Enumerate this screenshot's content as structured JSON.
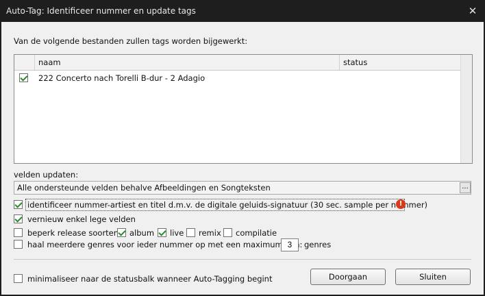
{
  "window": {
    "title": "Auto-Tag: Identificeer nummer en update tags"
  },
  "intro": "Van de volgende bestanden zullen tags worden bijgewerkt:",
  "table": {
    "columns": [
      "naam",
      "status"
    ],
    "rows": [
      {
        "checked": true,
        "name": "222 Concerto nach Torelli B-dur - 2 Adagio",
        "status": ""
      }
    ]
  },
  "fields": {
    "label": "velden updaten:",
    "value": "Alle ondersteunde velden behalve Afbeeldingen en Songteksten",
    "browse_label": "..."
  },
  "options": {
    "identify": {
      "label": "identificeer nummer-artiest en titel d.m.v. de digitale geluids-signatuur (30 sec. sample per nummer)",
      "checked": true,
      "warning_glyph": "!"
    },
    "only_empty": {
      "label": "vernieuw enkel lege velden",
      "checked": true
    },
    "limit_release": {
      "label": "beperk release soorten:",
      "checked": false,
      "types": [
        {
          "label": "album",
          "checked": true
        },
        {
          "label": "live",
          "checked": true
        },
        {
          "label": "remix",
          "checked": false
        },
        {
          "label": "compilatie",
          "checked": false
        }
      ]
    },
    "genres": {
      "label": "haal meerdere genres voor ieder nummer op met een maximum van:",
      "checked": false,
      "max": "3",
      "suffix": "genres"
    }
  },
  "footer": {
    "minimize_label": "minimaliseer naar de statusbalk wanneer Auto-Tagging begint",
    "minimize_checked": false,
    "proceed_label": "Doorgaan",
    "close_label": "Sluiten"
  },
  "colors": {
    "titlebar": "#1e1e1e",
    "client": "#f0f0f0",
    "check": "#2a8a2a",
    "warning": "#d63a1a"
  }
}
